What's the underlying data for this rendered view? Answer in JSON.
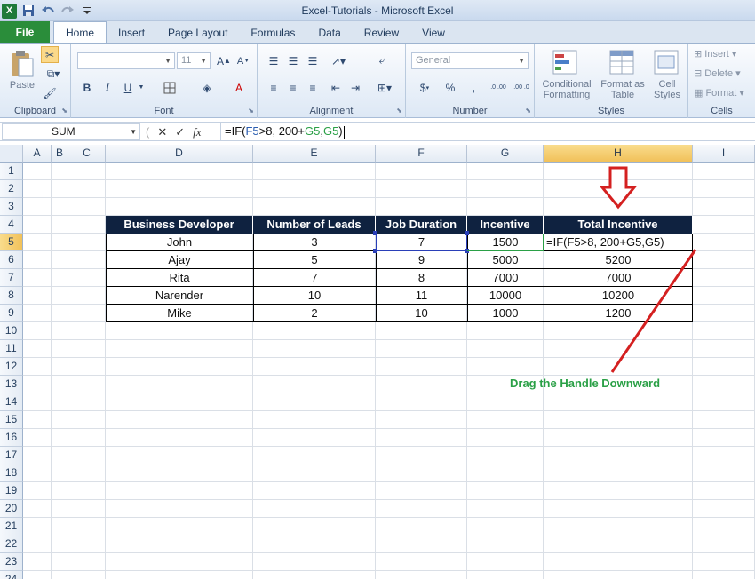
{
  "window": {
    "title": "Excel-Tutorials  -  Microsoft Excel"
  },
  "qat": {
    "icons": [
      "excel-logo",
      "save-icon",
      "undo-icon",
      "redo-icon",
      "customize-icon"
    ]
  },
  "tabs": [
    "File",
    "Home",
    "Insert",
    "Page Layout",
    "Formulas",
    "Data",
    "Review",
    "View"
  ],
  "active_tab": "Home",
  "ribbon": {
    "clipboard": {
      "label": "Clipboard",
      "paste": "Paste"
    },
    "font": {
      "label": "Font",
      "font_size": "11",
      "bold": "B",
      "italic": "I",
      "underline": "U"
    },
    "alignment": {
      "label": "Alignment"
    },
    "number": {
      "label": "Number",
      "format": "General",
      "currency": "$",
      "percent": "%",
      "comma": ",",
      "inc_dec": ".0 .00",
      "dec_dec": ".00 .0"
    },
    "styles": {
      "label": "Styles",
      "conditional": "Conditional Formatting",
      "format_table": "Format as Table",
      "cell_styles": "Cell Styles"
    },
    "cells": {
      "label": "Cells",
      "insert": "Insert",
      "delete": "Delete",
      "format": "Format"
    }
  },
  "formula_bar": {
    "name_box": "SUM",
    "formula_parts": [
      {
        "text": "=IF(",
        "color": "#111111"
      },
      {
        "text": "F5",
        "color": "#2a5db0"
      },
      {
        "text": ">8, 200+",
        "color": "#111111"
      },
      {
        "text": "G5",
        "color": "#2aa046"
      },
      {
        "text": ",",
        "color": "#111111"
      },
      {
        "text": "G5",
        "color": "#2aa046"
      },
      {
        "text": ")",
        "color": "#111111"
      }
    ]
  },
  "columns": [
    "A",
    "B",
    "C",
    "D",
    "E",
    "F",
    "G",
    "H",
    "I"
  ],
  "selected_column": "H",
  "rows": [
    "1",
    "2",
    "3",
    "4",
    "5",
    "6",
    "7",
    "8",
    "9",
    "10",
    "11",
    "12",
    "13",
    "14",
    "15",
    "16",
    "17",
    "18",
    "19",
    "20",
    "21",
    "22",
    "23",
    "24"
  ],
  "selected_row": "5",
  "table": {
    "headers": [
      "Business Developer",
      "Number of Leads",
      "Job Duration",
      "Incentive",
      "Total Incentive"
    ],
    "rows": [
      [
        "John",
        "3",
        "7",
        "1500",
        "=IF(F5>8, 200+G5,G5)"
      ],
      [
        "Ajay",
        "5",
        "9",
        "5000",
        "5200"
      ],
      [
        "Rita",
        "7",
        "8",
        "7000",
        "7000"
      ],
      [
        "Narender",
        "10",
        "11",
        "10000",
        "10200"
      ],
      [
        "Mike",
        "2",
        "10",
        "1000",
        "1200"
      ]
    ]
  },
  "annotation": {
    "text": "Drag the Handle Downward",
    "color": "#2aa046",
    "arrow_color": "#d42020"
  },
  "colors": {
    "header_bg": "#0f2240",
    "file_tab": "#2a8d3a",
    "selected_header": "#f1c15a"
  }
}
